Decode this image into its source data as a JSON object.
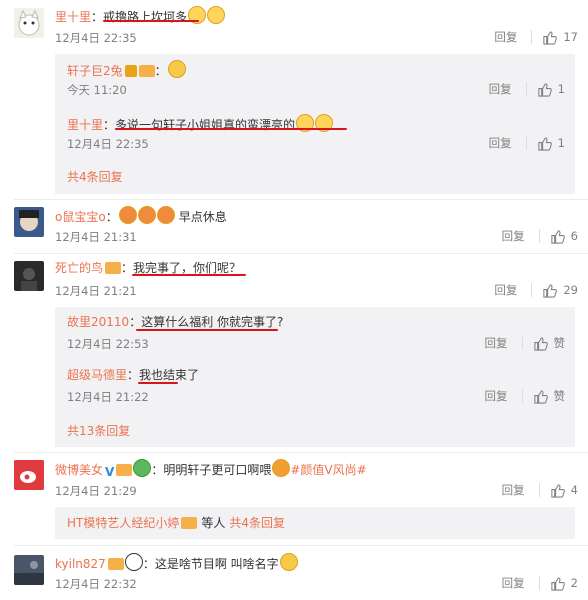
{
  "comments": [
    {
      "name": "里十里",
      "text": "戒撸路上坎坷多",
      "time": "12月4日 22:35",
      "reply": "回复",
      "likes": "17"
    },
    {
      "name": "o鼠宝宝o",
      "text": "早点休息",
      "time": "12月4日 21:31",
      "reply": "回复",
      "likes": "6"
    },
    {
      "name": "死亡的鸟",
      "text": "我完事了，你们呢？",
      "time": "12月4日 21:21",
      "reply": "回复",
      "likes": "29"
    },
    {
      "name": "微博美女",
      "text": "明明轩子更可口啊喂",
      "topic": "#颜值V风尚#",
      "time": "12月4日 21:29",
      "reply": "回复",
      "likes": "4"
    },
    {
      "name": "kyiln827",
      "text": "这是啥节目啊 叫啥名字",
      "time": "12月4日 22:32",
      "reply": "回复",
      "likes": "2"
    }
  ],
  "sub1": {
    "replies": [
      {
        "name": "轩子巨2兔",
        "text": "",
        "time": "今天 11:20",
        "reply": "回复",
        "likes": "1"
      },
      {
        "name": "里十里",
        "text": "多说一句轩子小姐姐真的蛮漂亮的",
        "time": "12月4日 22:35",
        "reply": "回复",
        "likes": "1"
      }
    ],
    "more": "共4条回复"
  },
  "sub2": {
    "replies": [
      {
        "name": "故里20110",
        "text": "这算什么福利 你就完事了?",
        "time": "12月4日 22:53",
        "reply": "回复",
        "likes": "赞"
      },
      {
        "name": "超级马德里",
        "text": "我也结束了",
        "time": "12月4日 21:22",
        "reply": "回复",
        "likes": "赞"
      }
    ],
    "more": "共13条回复"
  },
  "sub3": {
    "name": "HT模特艺人经纪小婷",
    "text": "等人",
    "more": "共4条回复"
  },
  "colors": {
    "name": "#eb7350",
    "underline": "#d8151b",
    "subbg": "#f2f2f5",
    "time": "#808080"
  }
}
